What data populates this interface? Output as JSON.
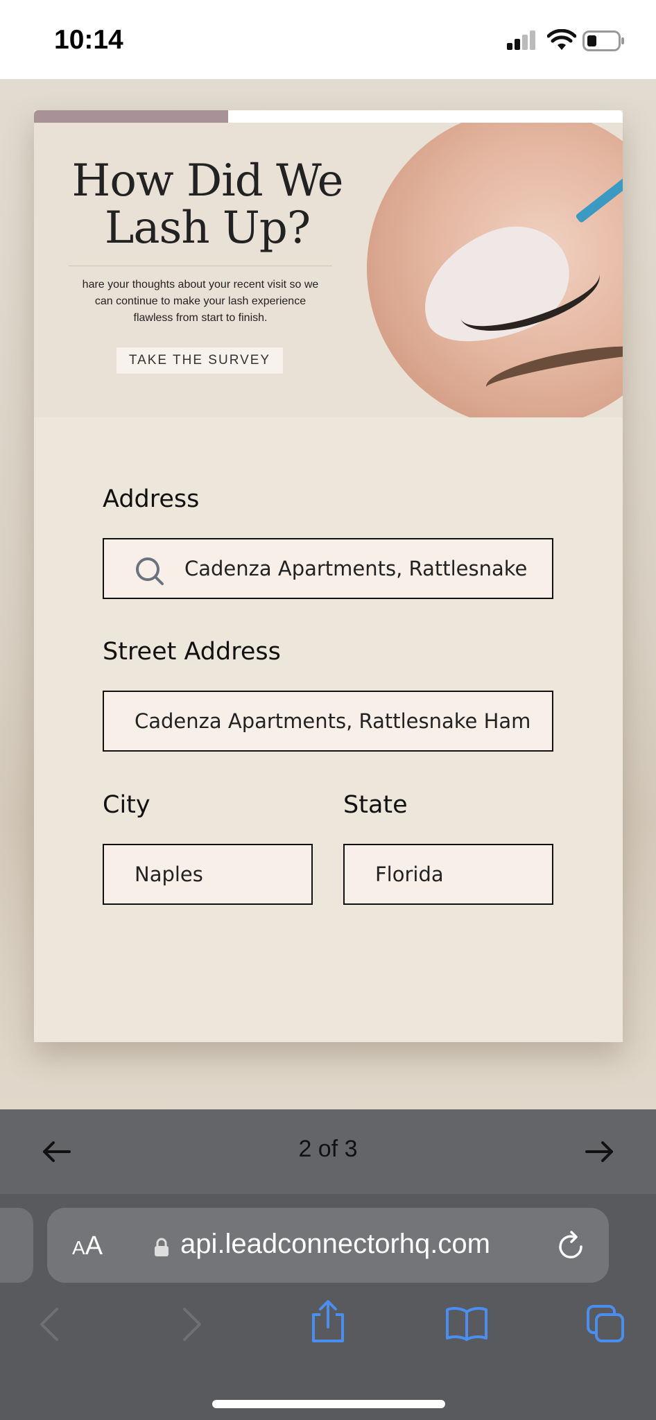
{
  "status_bar": {
    "time": "10:14"
  },
  "survey": {
    "progress_fraction": 0.33,
    "banner": {
      "title": "How Did We Lash Up?",
      "subtitle": "hare your thoughts about your recent visit so we can continue to make your lash experience flawless from start to finish.",
      "button": "TAKE THE SURVEY"
    },
    "form": {
      "address_label": "Address",
      "address_value": "Cadenza Apartments, Rattlesnake",
      "street_label": "Street Address",
      "street_value": "Cadenza Apartments, Rattlesnake Ham",
      "city_label": "City",
      "city_value": "Naples",
      "state_label": "State",
      "state_value": "Florida"
    }
  },
  "find_bar": {
    "count": "2 of 3"
  },
  "browser": {
    "aa_small": "A",
    "aa_large": "A",
    "url": "api.leadconnectorhq.com"
  },
  "colors": {
    "progress": "#a89298",
    "card": "#ede6da",
    "field": "#f8f0e8",
    "toolbar_icon": "#4a8ef0"
  }
}
